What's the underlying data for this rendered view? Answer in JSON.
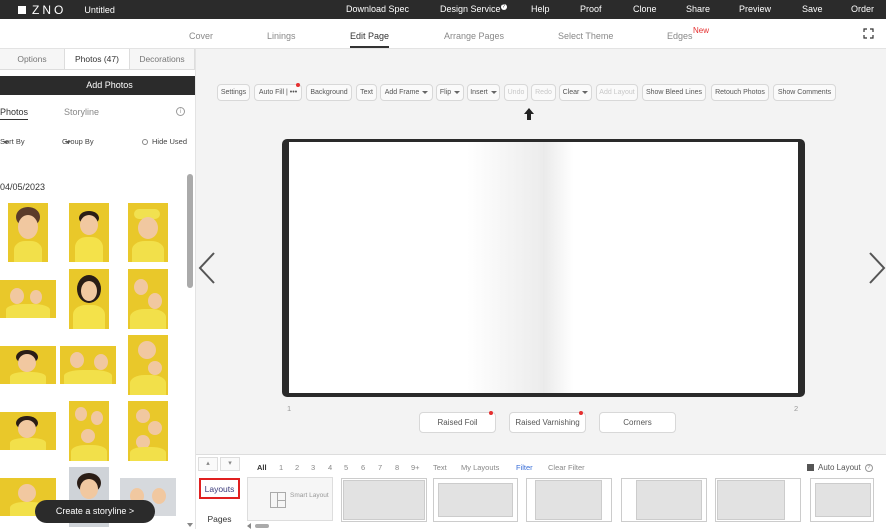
{
  "app": {
    "logo_text": "ZNO",
    "doc_title": "Untitled"
  },
  "topnav": {
    "download_spec": "Download Spec",
    "design_service": "Design Service",
    "help": "Help",
    "proof": "Proof",
    "clone": "Clone",
    "share": "Share",
    "preview": "Preview",
    "save": "Save",
    "order": "Order"
  },
  "subnav": {
    "cover": "Cover",
    "linings": "Linings",
    "edit_page": "Edit Page",
    "arrange_pages": "Arrange Pages",
    "select_theme": "Select Theme",
    "edges": "Edges",
    "edges_badge": "New"
  },
  "leftpanel": {
    "tab_options": "Options",
    "tab_photos": "Photos (47)",
    "tab_decorations": "Decorations",
    "add_photos": "Add Photos",
    "subtab_photos": "Photos",
    "subtab_storyline": "Storyline",
    "info": "i",
    "sort_by": "Sort By",
    "group_by": "Group By",
    "hide_used": "Hide Used",
    "date_group": "04/05/2023",
    "create_storyline": "Create a storyline >"
  },
  "toolbar": {
    "settings": "Settings",
    "auto_fill": "Auto Fill | •••",
    "background": "Background",
    "text": "Text",
    "add_frame": "Add Frame",
    "flip": "Flip",
    "insert": "Insert",
    "undo": "Undo",
    "redo": "Redo",
    "clear": "Clear",
    "add_layout": "Add Layout",
    "show_bleed_lines": "Show Bleed Lines",
    "retouch_photos": "Retouch Photos",
    "show_comments": "Show Comments"
  },
  "canvas": {
    "page_left_num": "1",
    "page_right_num": "2"
  },
  "effects": {
    "raised_foil": "Raised Foil",
    "raised_varnishing": "Raised Varnishing",
    "corners": "Corners"
  },
  "bottompanel": {
    "pager_up": "▴",
    "pager_down": "▾",
    "tab_layouts": "Layouts",
    "tab_pages": "Pages",
    "filter_all": "All",
    "filter_nums": [
      "1",
      "2",
      "3",
      "4",
      "5",
      "6",
      "7",
      "8",
      "9+"
    ],
    "filter_text": "Text",
    "filter_my_layouts": "My Layouts",
    "filter": "Filter",
    "clear_filter": "Clear Filter",
    "auto_layout": "Auto Layout",
    "auto_layout_help": "?",
    "smart_layout": "Smart Layout"
  },
  "colors": {
    "topbar_bg": "#2b2b2b",
    "accent_red": "#e53030",
    "filter_blue": "#3a6fd8",
    "photo_yellow": "#e9c82a"
  }
}
